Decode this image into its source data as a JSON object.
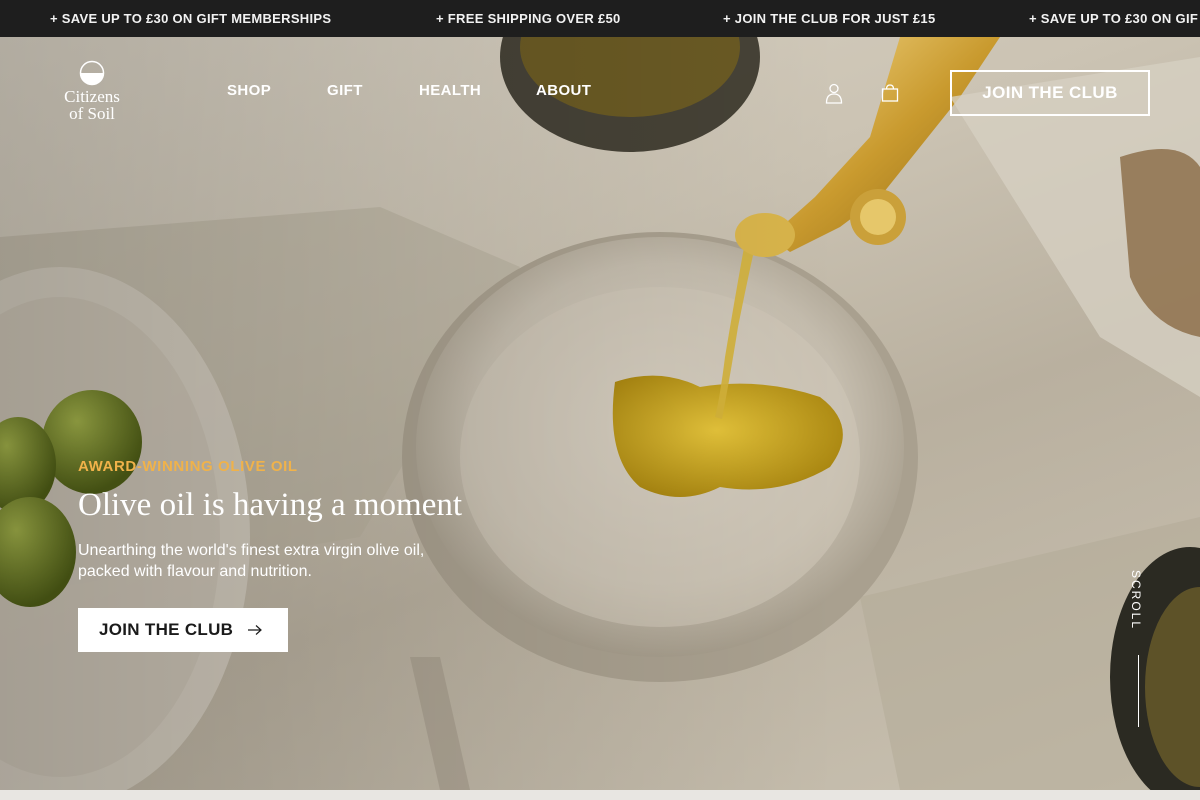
{
  "announcement_bar": {
    "items": [
      "+ SAVE UP TO £30 ON GIFT MEMBERSHIPS",
      "+ FREE SHIPPING OVER £50",
      "+ JOIN THE CLUB FOR JUST £15",
      "+ SAVE UP TO £30 ON GIF"
    ]
  },
  "header": {
    "logo": {
      "line1": "Citizens",
      "line2": "of Soil"
    },
    "nav": [
      {
        "label": "SHOP"
      },
      {
        "label": "GIFT"
      },
      {
        "label": "HEALTH"
      },
      {
        "label": "ABOUT"
      }
    ],
    "icons": {
      "account": "user-icon",
      "cart": "shopping-bag-icon"
    },
    "join_label": "JOIN THE CLUB"
  },
  "hero": {
    "eyebrow": "AWARD-WINNING OLIVE OIL",
    "headline": "Olive oil is having a moment",
    "subcopy": "Unearthing the world's finest extra virgin olive oil, packed with flavour and nutrition.",
    "cta_label": "JOIN THE CLUB",
    "cta_icon": "arrow-right-icon",
    "scroll_label": "SCROLL"
  },
  "colors": {
    "announcement_bg": "#1e1e1e",
    "accent": "#f0b24a",
    "text_on_hero": "#ffffff",
    "oil": "#c9a21a"
  }
}
